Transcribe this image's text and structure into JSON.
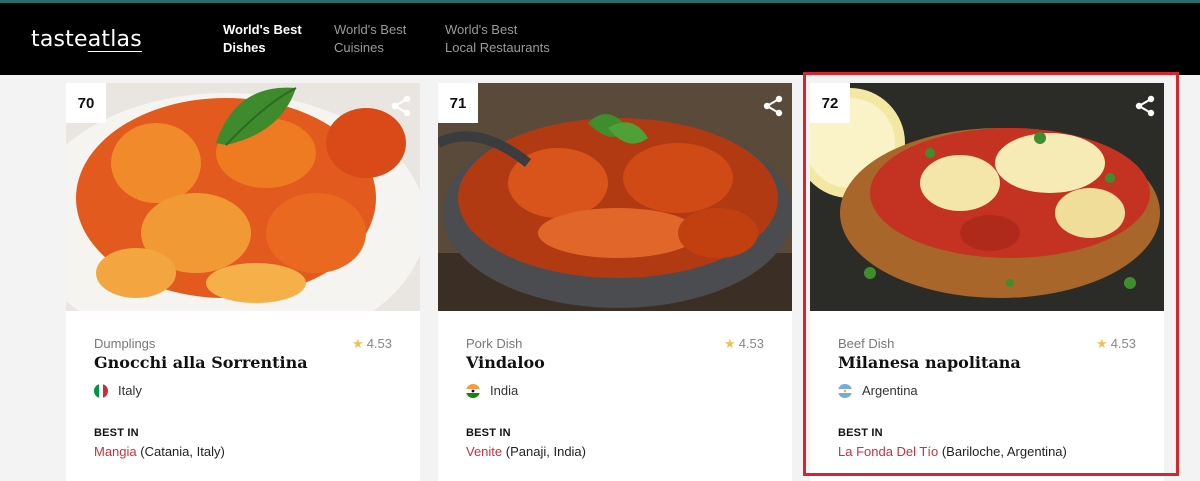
{
  "header": {
    "logo_a": "taste",
    "logo_b": "atlas",
    "nav": [
      {
        "line1": "World's Best",
        "line2": "Dishes"
      },
      {
        "line1": "World's Best",
        "line2": "Cuisines"
      },
      {
        "line1": "World's Best",
        "line2": "Local Restaurants"
      }
    ]
  },
  "cards": [
    {
      "rank": "70",
      "type": "Dumplings",
      "rating": "4.53",
      "name": "Gnocchi alla Sorrentina",
      "country": "Italy",
      "best_in_label": "BEST IN",
      "restaurant": "Mangia",
      "location": "(Catania, Italy)"
    },
    {
      "rank": "71",
      "type": "Pork Dish",
      "rating": "4.53",
      "name": "Vindaloo",
      "country": "India",
      "best_in_label": "BEST IN",
      "restaurant": "Venite",
      "location": "(Panaji, India)"
    },
    {
      "rank": "72",
      "type": "Beef Dish",
      "rating": "4.53",
      "name": "Milanesa napolitana",
      "country": "Argentina",
      "best_in_label": "BEST IN",
      "restaurant": "La Fonda Del Tío",
      "location": "(Bariloche, Argentina)"
    }
  ],
  "icons": {
    "share": "share-icon",
    "star": "star-icon"
  },
  "colors": {
    "accent": "#c8313e",
    "highlight": "#d5262f",
    "header": "#000000",
    "star": "#f2c14e"
  }
}
